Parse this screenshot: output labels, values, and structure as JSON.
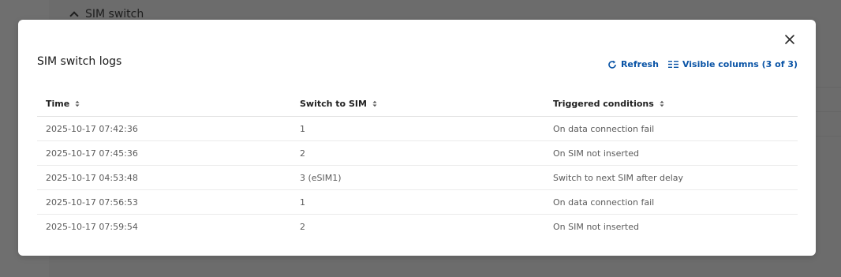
{
  "background": {
    "section_title": "SIM switch"
  },
  "modal": {
    "title": "SIM switch logs",
    "toolbar": {
      "refresh_label": "Refresh",
      "visible_columns_label": "Visible columns (3 of 3)"
    },
    "table": {
      "headers": [
        "Time",
        "Switch to SIM",
        "Triggered conditions"
      ],
      "rows": [
        [
          "2025-10-17 07:42:36",
          "1",
          "On data connection fail"
        ],
        [
          "2025-10-17 07:45:36",
          "2",
          "On SIM not inserted"
        ],
        [
          "2025-10-17 04:53:48",
          "3 (eSIM1)",
          "Switch to next SIM after delay"
        ],
        [
          "2025-10-17 07:56:53",
          "1",
          "On data connection fail"
        ],
        [
          "2025-10-17 07:59:54",
          "2",
          "On SIM not inserted"
        ]
      ]
    }
  },
  "colors": {
    "accent": "#0a54a6",
    "overlay": "#6f6f6f",
    "text_primary": "#1f1f1f",
    "text_secondary": "#5b5b5b"
  },
  "icons": {
    "close": "close-icon",
    "refresh": "refresh-icon",
    "columns": "columns-icon",
    "sort": "sort-icon"
  }
}
